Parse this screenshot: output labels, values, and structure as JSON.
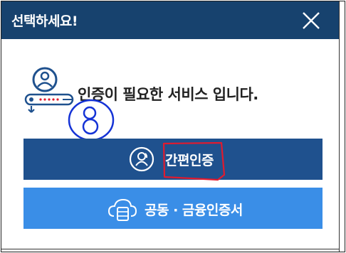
{
  "header": {
    "title": "선택하세요!",
    "close_icon": "close-icon",
    "background": "#17426e"
  },
  "body": {
    "icon": "user-auth-icon",
    "message": "인증이 필요한 서비스 입니다.",
    "handwritten_annotation": "8"
  },
  "buttons": {
    "simple_auth": {
      "label": "간편인증",
      "icon": "user-circle-icon",
      "color": "#1f518e",
      "highlighted": true
    },
    "joint_cert": {
      "label": "공동 · 금융인증서",
      "icon": "cloud-server-icon",
      "color": "#3a8ee7"
    }
  },
  "colors": {
    "annotation_blue": "#1533d6",
    "annotation_red": "#e01b2f"
  }
}
